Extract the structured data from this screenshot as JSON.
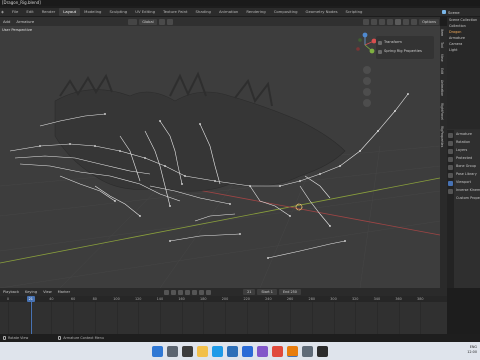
{
  "window": {
    "title": "[Dragon_Rig.blend]"
  },
  "workspace_tabs": [
    "Layout",
    "Modeling",
    "Sculpting",
    "UV Editing",
    "Texture Paint",
    "Shading",
    "Animation",
    "Rendering",
    "Compositing",
    "Geometry Nodes",
    "Scripting"
  ],
  "active_tab": "Layout",
  "top_right": {
    "scene_label": "Scene"
  },
  "viewport_header": {
    "menus": [
      "Add",
      "Armature"
    ],
    "transform_orientation": "Global",
    "options_label": "Options"
  },
  "viewport": {
    "overlay_title": "User Perspective"
  },
  "sidebar_tabs": [
    "Item",
    "Tool",
    "View",
    "Edit",
    "Animation",
    "RightPanel",
    "RigProperties"
  ],
  "props_popup": {
    "items": [
      "Transform",
      "Spring Rig Properties"
    ]
  },
  "outliner": {
    "rows": [
      "Scene Collection",
      "Collection",
      "Dragon",
      "Armature",
      "Camera",
      "Light"
    ]
  },
  "properties": {
    "rows": [
      "Armature",
      "Rotation",
      "Layers",
      "Protected",
      "Bone Group",
      "Pose Library",
      "Viewport",
      "Inverse Kinematics",
      "Custom Properties"
    ]
  },
  "timeline": {
    "menus": [
      "Playback",
      "Keying",
      "View",
      "Marker"
    ],
    "current_frame": 21,
    "start_label": "Start",
    "start_value": "1",
    "end_label": "End",
    "end_value": "250",
    "frame_field": "21",
    "ticks": [
      0,
      20,
      40,
      60,
      80,
      100,
      120,
      140,
      160,
      180,
      200,
      220,
      240,
      260,
      280,
      300,
      320,
      340,
      360,
      380
    ]
  },
  "status_bar": {
    "items": [
      "Rotate View",
      "Armature Context Menu"
    ]
  },
  "taskbar": {
    "icons": [
      "windows-icon",
      "search-icon",
      "taskview-icon",
      "explorer-icon",
      "edge-icon",
      "store-icon",
      "mail-icon",
      "photos-icon",
      "chrome-icon",
      "blender-icon",
      "settings-icon",
      "terminal-icon"
    ],
    "language": "ENG",
    "time": "12:00",
    "date": "01/01/2024"
  },
  "colors": {
    "accent": "#4772b3",
    "viewport_bg": "#3d3d3d",
    "panel_bg": "#2d2d2d"
  }
}
